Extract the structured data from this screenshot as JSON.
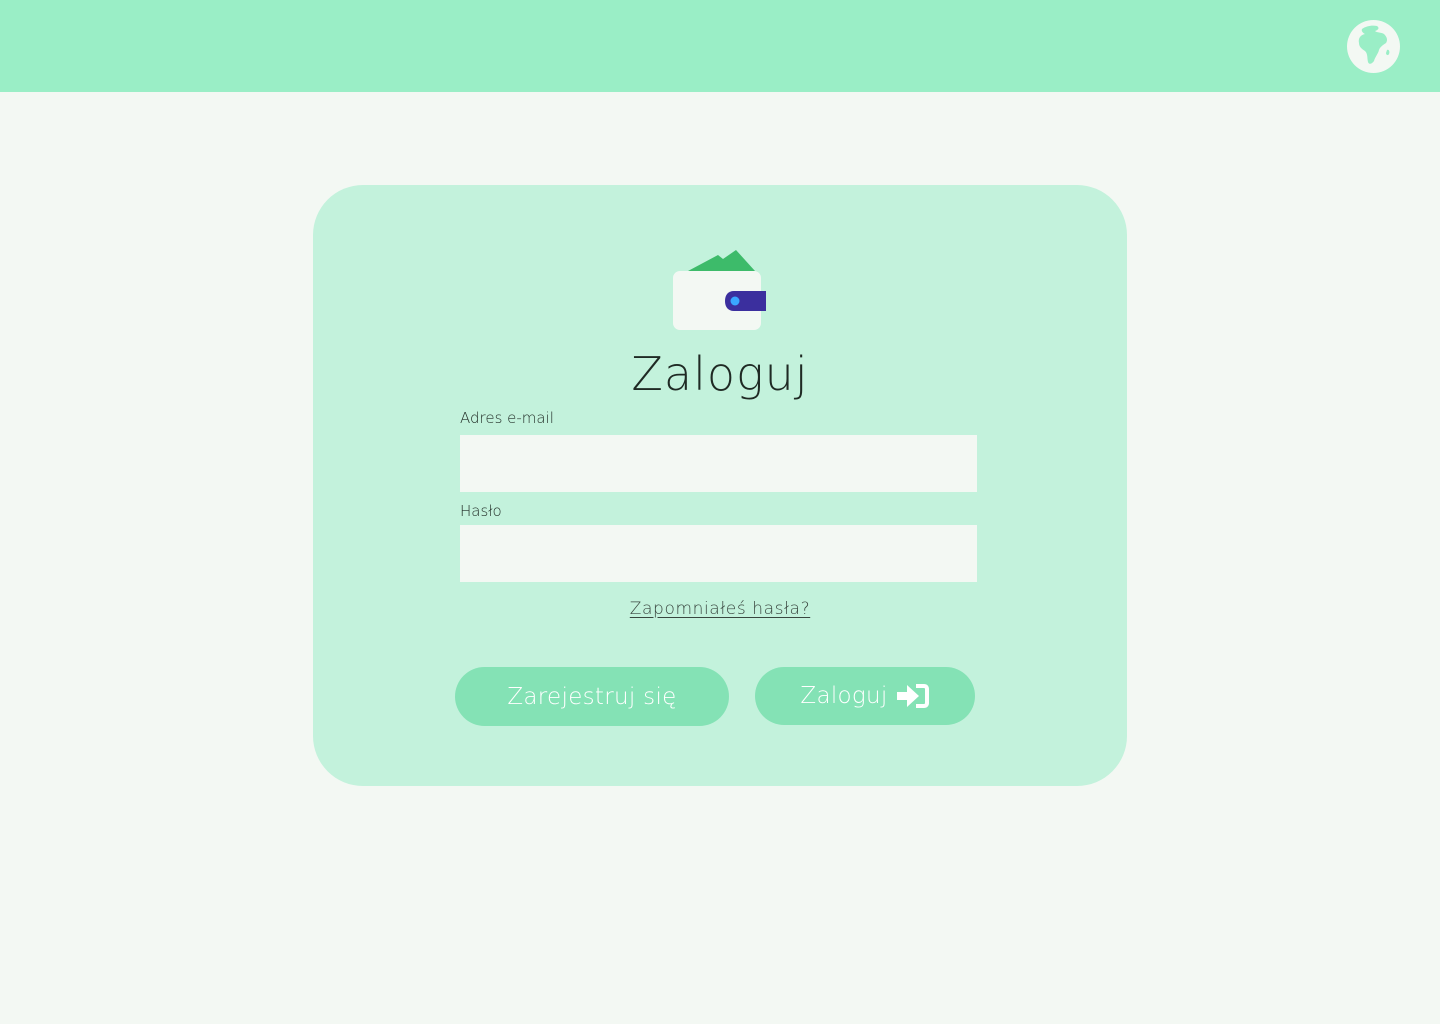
{
  "header": {
    "language_icon": "globe-africa-icon"
  },
  "logo": {
    "icon": "wallet-icon",
    "colors": {
      "wallet_body": "#f3f8f3",
      "banknote": "#3dbb6a",
      "clasp": "#3b2f9e",
      "clasp_dot": "#3aa6ff"
    }
  },
  "login": {
    "title": "Zaloguj",
    "email_label": "Adres e-mail",
    "email_value": "",
    "password_label": "Hasło",
    "password_value": "",
    "forgot_link": "Zapomniałeś hasła?",
    "register_button": "Zarejestruj się",
    "login_button": "Zaloguj",
    "login_button_icon": "sign-in-icon"
  },
  "colors": {
    "header_bg": "#9aeec6",
    "page_bg": "#f3f8f3",
    "card_bg": "#c3f2dc",
    "button_bg": "#84e2b5",
    "text": "#1f2a24"
  }
}
